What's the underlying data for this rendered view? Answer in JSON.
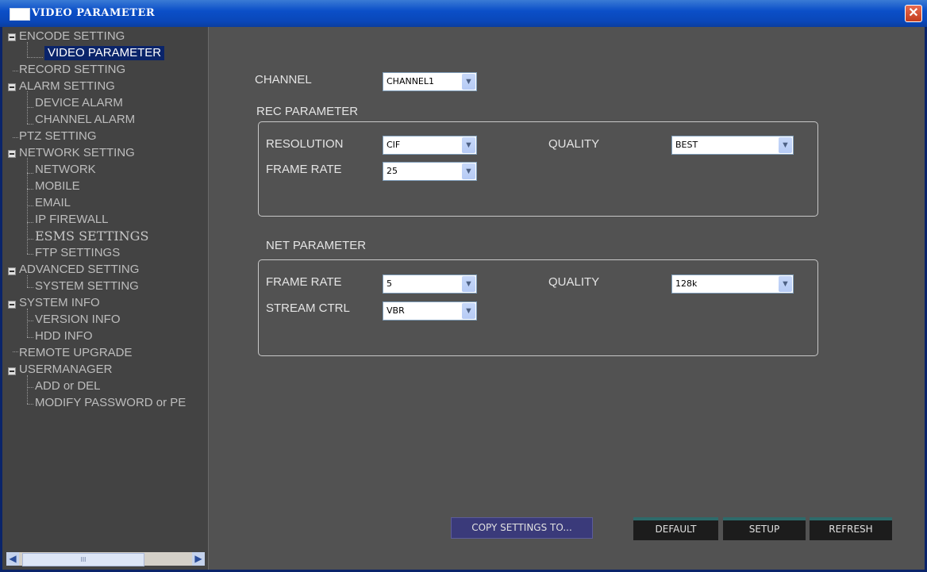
{
  "window": {
    "title": "VIDEO PARAMETER",
    "close_label": "✕"
  },
  "tree": {
    "items": [
      "ENCODE SETTING",
      "VIDEO PARAMETER",
      "RECORD SETTING",
      "ALARM SETTING",
      "DEVICE ALARM",
      "CHANNEL ALARM",
      "PTZ SETTING",
      "NETWORK SETTING",
      "NETWORK",
      "MOBILE",
      "EMAIL",
      "IP FIREWALL",
      "ESMS SETTINGS",
      "FTP SETTINGS",
      "ADVANCED SETTING",
      "SYSTEM SETTING",
      "SYSTEM INFO",
      "VERSION INFO",
      "HDD INFO",
      "REMOTE UPGRADE",
      "USERMANAGER",
      "ADD or DEL",
      "MODIFY PASSWORD or PE"
    ],
    "selected": "VIDEO PARAMETER",
    "scroll_thumb": "III"
  },
  "main": {
    "channel_label": "CHANNEL",
    "channel_value": "CHANNEL1",
    "rec_title": "REC PARAMETER",
    "rec": {
      "resolution_label": "RESOLUTION",
      "resolution_value": "CIF",
      "quality_label": "QUALITY",
      "quality_value": "BEST",
      "framerate_label": "FRAME RATE",
      "framerate_value": "25"
    },
    "net_title": "NET PARAMETER",
    "net": {
      "framerate_label": "FRAME RATE",
      "framerate_value": "5",
      "quality_label": "QUALITY",
      "quality_value": "128k",
      "stream_label": "STREAM CTRL",
      "stream_value": "VBR"
    }
  },
  "buttons": {
    "copy": "COPY SETTINGS TO...",
    "default": "DEFAULT",
    "setup": "SETUP",
    "refresh": "REFRESH"
  },
  "colors": {
    "titlebar": "#0b4fc8",
    "panel": "#525252",
    "tree_bg": "#434343",
    "selection": "#0a246a"
  }
}
